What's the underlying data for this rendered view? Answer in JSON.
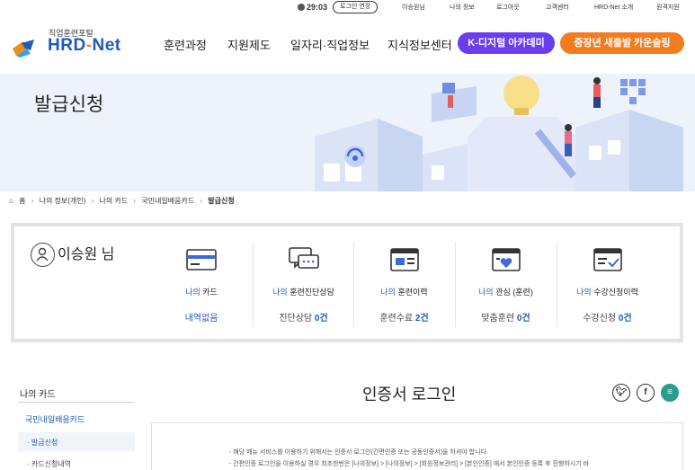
{
  "utility": {
    "timer": "29:03",
    "extend_label": "로그인 연장",
    "links": [
      "이승원님",
      "나의 정보",
      "로그아웃",
      "고객센터",
      "HRD-Net 소개",
      "원격지원"
    ]
  },
  "logo": {
    "sub": "직업훈련포털",
    "main_left": "HRD",
    "main_dash": "-",
    "main_right": "Net"
  },
  "gnb": {
    "items": [
      "훈련과정",
      "지원제도",
      "일자리·직업정보",
      "지식정보센터"
    ],
    "kdigital": "K-디지털 아카데미",
    "counsel": "중장년 새출발 카운슬링"
  },
  "banner": {
    "title": "발급신청"
  },
  "breadcrumb": [
    "홈",
    "나의 정보(개인)",
    "나의 카드",
    "국민내일배움카드",
    "발급신청"
  ],
  "summary": {
    "user_name": "이승원",
    "user_suffix": " 님",
    "items": [
      {
        "icon": "card-icon",
        "label_blue": "나의",
        "label_rest": " 카드",
        "value_text": "내역없음",
        "value_num": ""
      },
      {
        "icon": "chat-icon",
        "label_blue": "나의",
        "label_rest": " 훈련진단상담",
        "value_text": "진단상담 ",
        "value_num": "0건"
      },
      {
        "icon": "record-icon",
        "label_blue": "나의",
        "label_rest": " 훈련이력",
        "value_text": "훈련수료 ",
        "value_num": "2건"
      },
      {
        "icon": "heart-icon",
        "label_blue": "나의",
        "label_rest": " 관심 (훈련)",
        "value_text": "맞춤훈련 ",
        "value_num": "0건"
      },
      {
        "icon": "check-icon",
        "label_blue": "나의",
        "label_rest": " 수강신청이력",
        "value_text": "수강신청 ",
        "value_num": "0건"
      }
    ]
  },
  "lnb": {
    "title": "나의 카드",
    "sub": "국민내일배움카드",
    "items": [
      "· 발급신청",
      "· 카드신청내역"
    ]
  },
  "cert": {
    "title": "인증서 로그인",
    "notice": [
      "- 해당 메뉴 서비스를 이용하기 위해서는 인증서 로그인(간편인증 또는 공동인증서)을 하셔야 합니다.",
      "- 간편인증 로그인을 이용하실 경우 최초한번은 [나의정보] > [나의정보] > [회원정보관리] > [본인인증] 에서 본인인증 등록 후 진행하시기 바"
    ]
  },
  "colors": {
    "brand_blue": "#1f5bb8",
    "accent_orange": "#f47c20",
    "accent_purple": "#6a3df0",
    "banner_bg": "#eef2fb"
  }
}
